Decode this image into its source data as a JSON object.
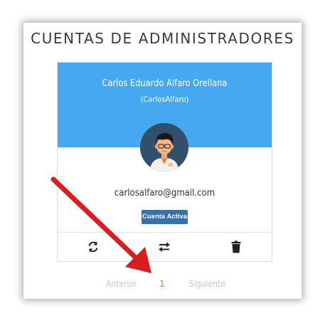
{
  "panel": {
    "title": "CUENTAS DE ADMINISTRADORES"
  },
  "account_card": {
    "full_name": "Carlos Eduardo Alfaro Orellana",
    "username": "(CarlosAlfaro)",
    "email": "carlosalfaro@gmail.com",
    "status_label": "Cuenta Activa",
    "header_color": "#46a8ef",
    "status_color": "#3271b2",
    "avatar_icon": "user-avatar-glasses-icon",
    "actions": [
      {
        "name": "refresh-icon"
      },
      {
        "name": "swap-arrows-icon"
      },
      {
        "name": "trash-icon"
      }
    ]
  },
  "pagination": {
    "previous_label": "Anterior",
    "current_page": "1",
    "next_label": "Siguiente",
    "active_color": "#e07c4c"
  },
  "annotation": {
    "arrow_color": "#d81e1e",
    "arrow_icon": "red-pointer-arrow"
  }
}
